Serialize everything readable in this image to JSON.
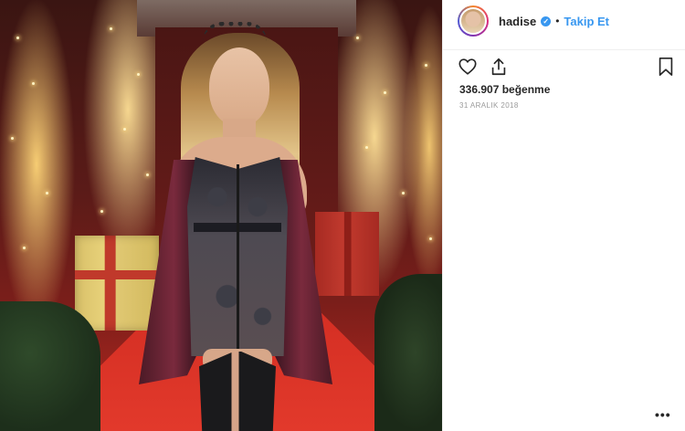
{
  "post": {
    "username": "hadise",
    "follow_label": "Takip Et",
    "likes_text": "336.907 beğenme",
    "date_text": "31 ARALIK 2018",
    "separator": "•",
    "more_label": "•••"
  },
  "icons": {
    "verified": "verified-badge-icon",
    "like": "heart-icon",
    "share": "share-icon",
    "save": "bookmark-icon",
    "more": "more-options-icon"
  },
  "colors": {
    "accent": "#3897f0",
    "text": "#262626",
    "muted": "#999999",
    "border": "#efefef"
  }
}
